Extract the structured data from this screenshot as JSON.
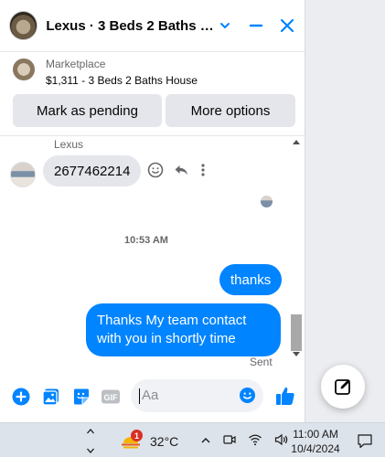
{
  "header": {
    "title": "Lexus · 3 Beds 2 Baths Ho...",
    "icons": [
      "chevron-down-icon",
      "minimize-icon",
      "close-icon"
    ],
    "accent_color": "#0084ff"
  },
  "marketplace": {
    "source": "Marketplace",
    "listing": "$1,311 - 3 Beds 2 Baths House",
    "mark_pending_label": "Mark as pending",
    "more_options_label": "More options"
  },
  "conversation": {
    "sender_name": "Lexus",
    "their_message": "2677462214",
    "timestamp": "10:53 AM",
    "my_messages": [
      "thanks",
      "Thanks My team contact with you in shortly time"
    ],
    "status": "Sent"
  },
  "composer": {
    "placeholder": "Aa",
    "icons": [
      "add-icon",
      "photo-icon",
      "sticker-icon",
      "gif-icon",
      "emoji-icon",
      "like-icon"
    ],
    "gif_label": "GIF"
  },
  "taskbar": {
    "temperature": "32°C",
    "weather_badge": "1",
    "time": "11:00 AM",
    "date": "10/4/2024"
  }
}
